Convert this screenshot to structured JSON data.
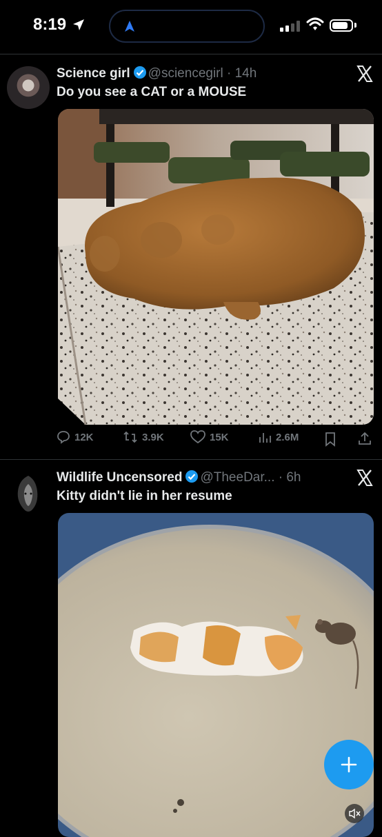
{
  "status_bar": {
    "time": "8:19",
    "icons": [
      "location-arrow-icon",
      "signal-icon",
      "wifi-icon",
      "battery-icon"
    ]
  },
  "tweets": [
    {
      "display_name": "Science girl",
      "handle": "@sciencegirl",
      "age": "· 14h",
      "text": "Do you see a CAT or a MOUSE",
      "media": "potato-shaped-like-a-cat-or-mouse-photo",
      "actions": {
        "replies": "12K",
        "reposts": "3.9K",
        "likes": "15K",
        "views": "2.6M"
      }
    },
    {
      "display_name": "Wildlife Uncensored",
      "handle": "@TheeDar...",
      "age": "· 6h",
      "text": "Kitty didn't lie in her resume",
      "media": "kitten-and-mouse-in-basin-video"
    }
  ],
  "colors": {
    "accent": "#1d9bf0",
    "secondary_text": "#71767b",
    "text": "#e7e9ea",
    "background": "#000000"
  }
}
